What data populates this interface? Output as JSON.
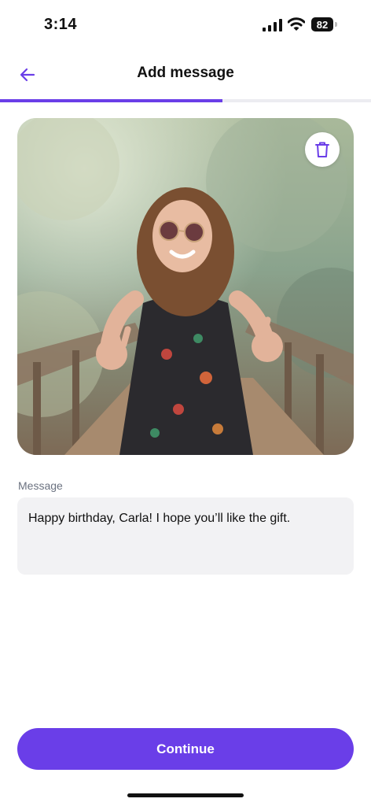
{
  "status_bar": {
    "time": "3:14",
    "battery": "82"
  },
  "header": {
    "title": "Add message"
  },
  "progress": {
    "fraction": 0.6
  },
  "photo": {
    "description_icon": "photo"
  },
  "message": {
    "label": "Message",
    "value": "Happy birthday, Carla! I hope you’ll like the gift."
  },
  "footer": {
    "continue_label": "Continue"
  },
  "colors": {
    "accent": "#6a3ee8",
    "field_bg": "#f2f2f4",
    "label": "#6b7280"
  },
  "icons": {
    "back": "arrow-left-icon",
    "delete": "trash-icon",
    "signal": "signal-icon",
    "wifi": "wifi-icon",
    "battery": "battery-icon"
  }
}
